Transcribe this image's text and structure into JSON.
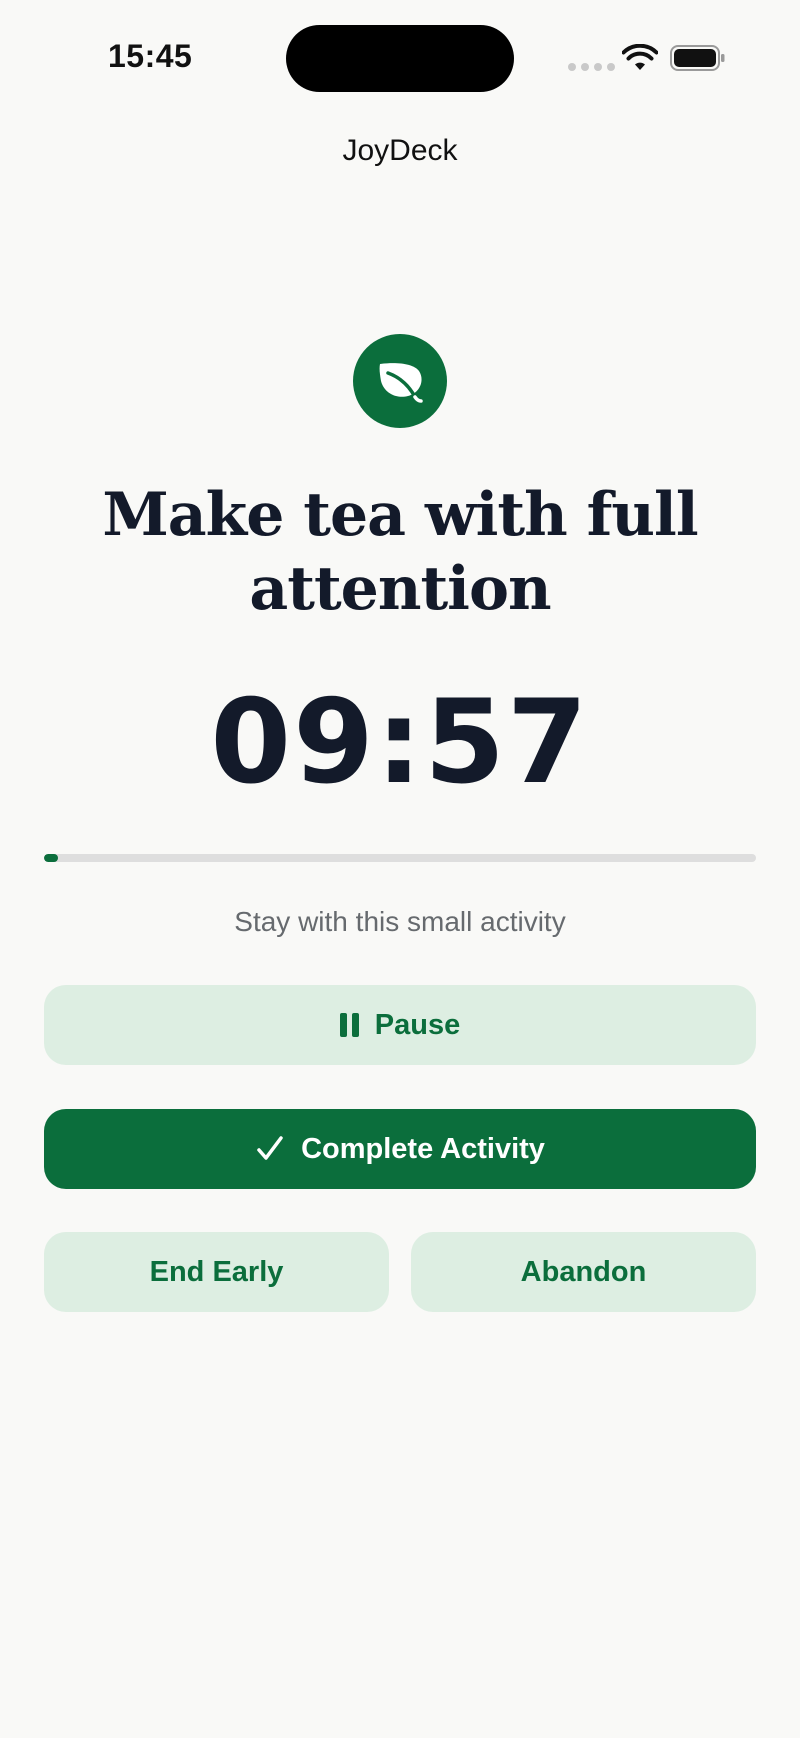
{
  "status_bar": {
    "time": "15:45",
    "signal_icon": "cellular-dots-icon",
    "wifi_icon": "wifi-icon",
    "battery_icon": "battery-icon"
  },
  "header": {
    "title": "JoyDeck"
  },
  "activity": {
    "icon": "leaf-icon",
    "title": "Make tea with full attention",
    "timer": "09:57",
    "progress_percent": 2,
    "subtitle": "Stay with this small activity"
  },
  "actions": {
    "pause_label": "Pause",
    "complete_label": "Complete Activity",
    "end_early_label": "End Early",
    "abandon_label": "Abandon"
  },
  "colors": {
    "accent": "#0b6e3c",
    "soft_button": "#ddeee2",
    "text_dark": "#131a2a",
    "text_muted": "#666a6e",
    "background": "#f9f9f7"
  }
}
